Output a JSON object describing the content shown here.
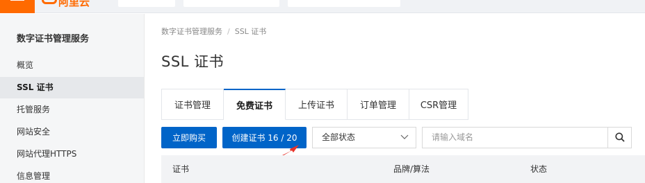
{
  "topbar": {
    "logo_text": "阿里云"
  },
  "sidebar": {
    "title": "数字证书管理服务",
    "items": [
      {
        "label": "概览"
      },
      {
        "label": "SSL 证书"
      },
      {
        "label": "托管服务"
      },
      {
        "label": "网站安全"
      },
      {
        "label": "网站代理HTTPS"
      },
      {
        "label": "信息管理"
      }
    ]
  },
  "breadcrumb": {
    "items": [
      "数字证书管理服务",
      "SSL 证书"
    ],
    "separator": "/"
  },
  "page_title": "SSL 证书",
  "tabs": [
    {
      "label": "证书管理"
    },
    {
      "label": "免费证书"
    },
    {
      "label": "上传证书"
    },
    {
      "label": "订单管理"
    },
    {
      "label": "CSR管理"
    }
  ],
  "toolbar": {
    "buy_label": "立即购买",
    "create_label": "创建证书 16 / 20",
    "status_select": "全部状态",
    "search_placeholder": "请输入域名"
  },
  "table": {
    "columns": [
      "证书",
      "品牌/算法",
      "状态"
    ]
  },
  "colors": {
    "accent": "#0064c8",
    "brand": "#ff6a00",
    "annotation_arrow": "#e8332a"
  }
}
